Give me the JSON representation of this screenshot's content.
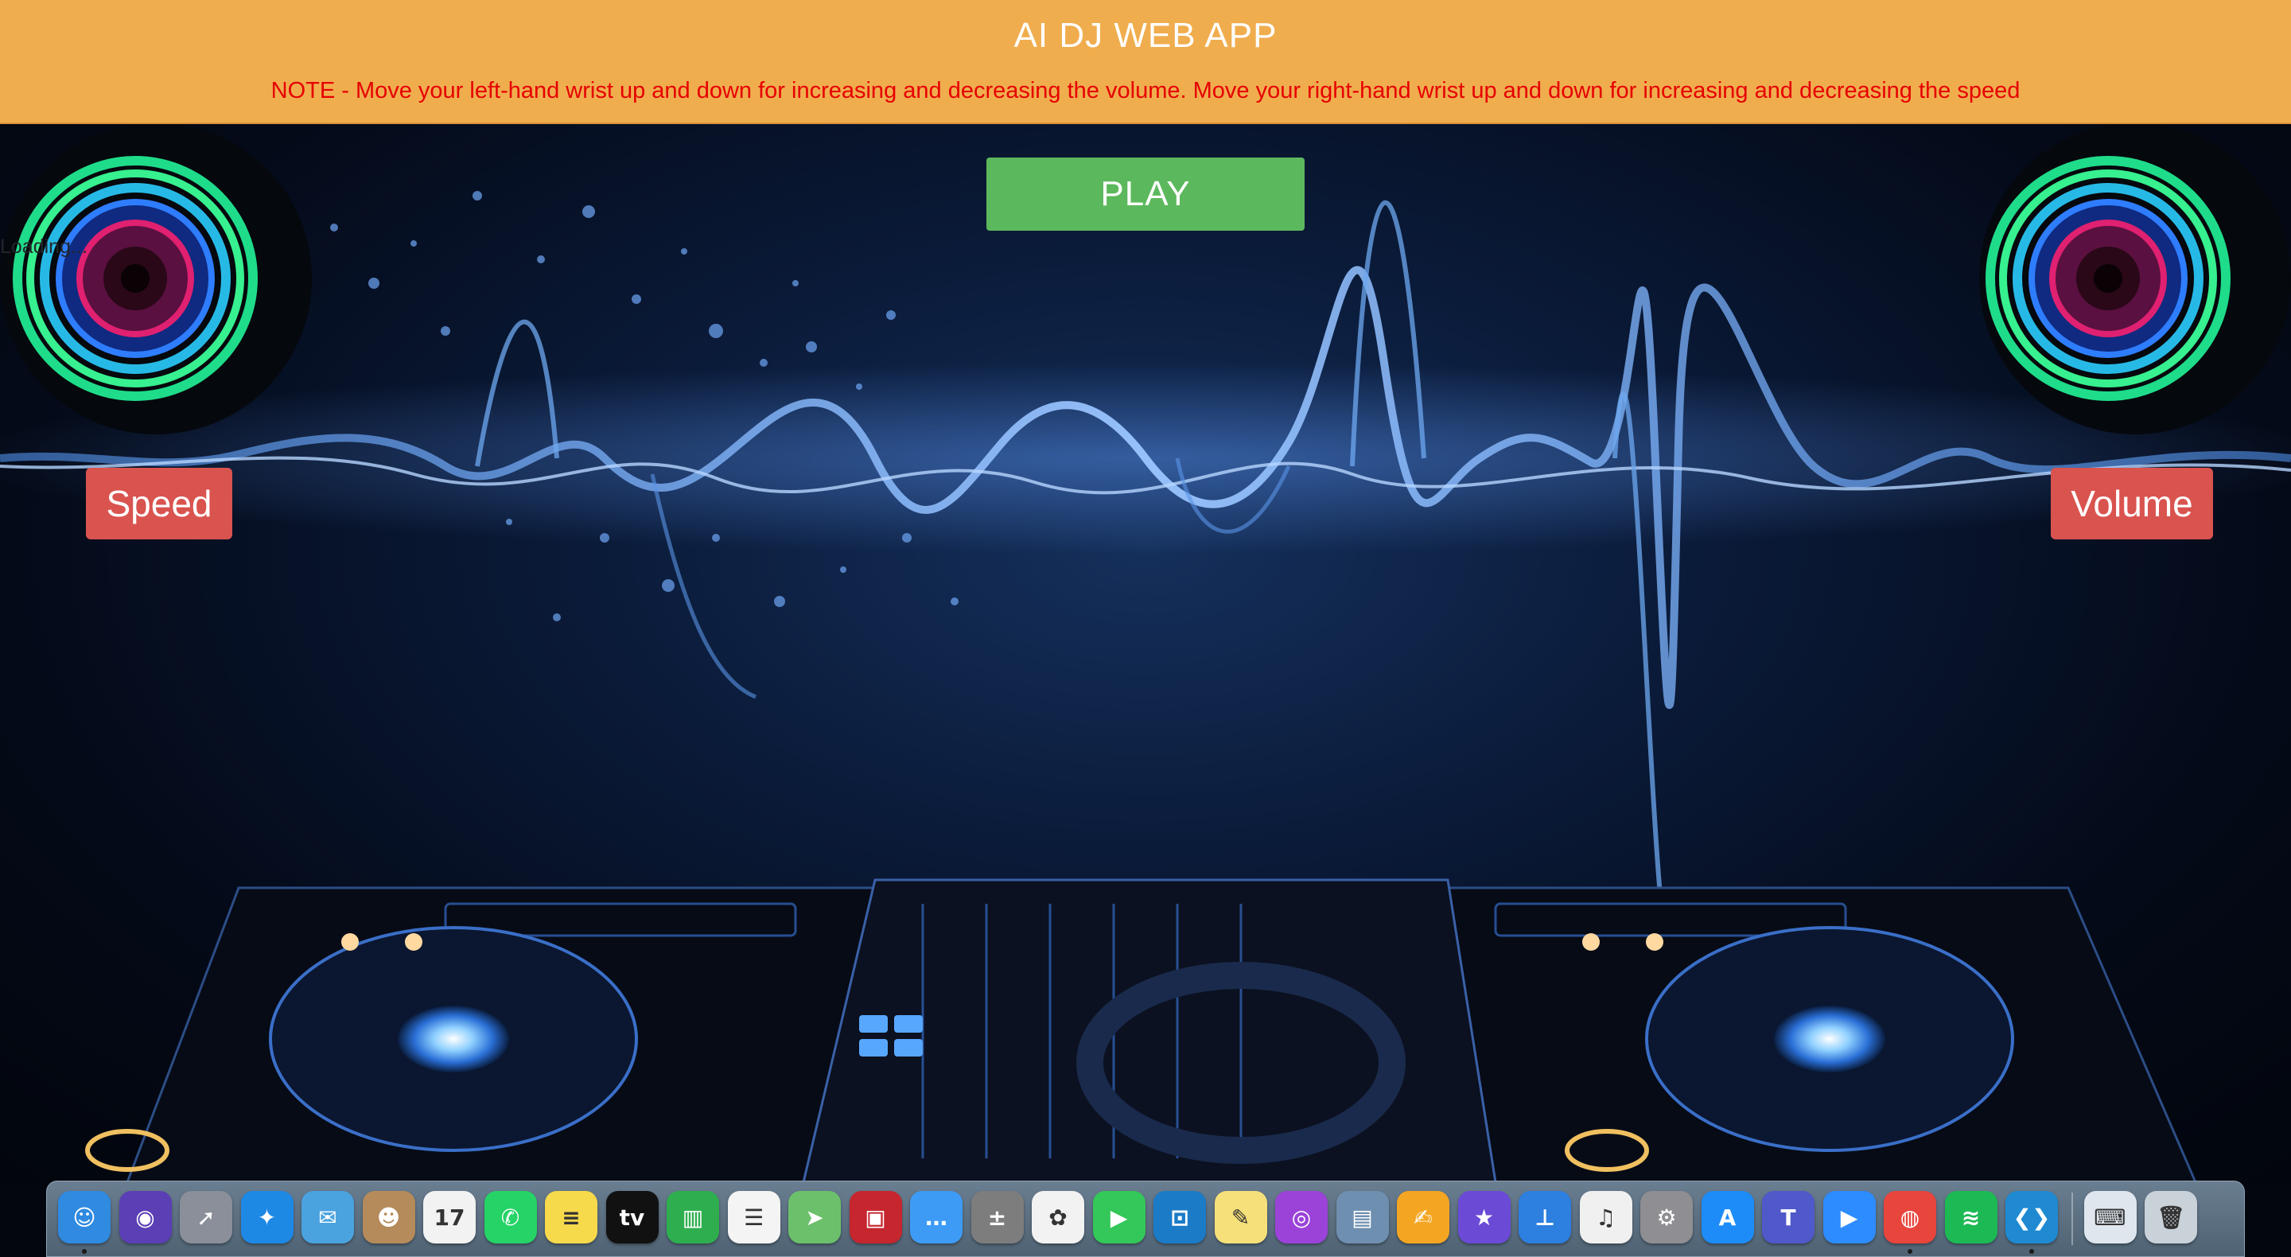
{
  "header": {
    "title": "AI DJ WEB APP",
    "note": "NOTE - Move your left-hand wrist up and down for increasing and decreasing the volume. Move your right-hand wrist up and down for increasing and decreasing the speed"
  },
  "controls": {
    "play_label": "PLAY",
    "speed_label": "Speed",
    "volume_label": "Volume",
    "loading_text": "Loading..."
  },
  "colors": {
    "header_bg": "#f0ad4e",
    "note_text": "#e60000",
    "play_bg": "#5cb85c",
    "control_bg": "#d9534f"
  },
  "dock": {
    "apps": [
      {
        "name": "finder-icon",
        "glyph": "☺",
        "color": "#2f8ae0",
        "running": true
      },
      {
        "name": "siri-icon",
        "glyph": "◉",
        "color": "#5b3fb5",
        "running": false
      },
      {
        "name": "launchpad-icon",
        "glyph": "➚",
        "color": "#8a8f99",
        "running": false
      },
      {
        "name": "safari-icon",
        "glyph": "✦",
        "color": "#1e88e5",
        "running": false
      },
      {
        "name": "mail-icon",
        "glyph": "✉",
        "color": "#4aa3df",
        "running": false
      },
      {
        "name": "contacts-icon",
        "glyph": "☻",
        "color": "#b58b5b",
        "running": false
      },
      {
        "name": "calendar-icon",
        "glyph": "17",
        "color": "#f2f2f2",
        "running": false
      },
      {
        "name": "whatsapp-icon",
        "glyph": "✆",
        "color": "#25d366",
        "running": false
      },
      {
        "name": "notes-icon",
        "glyph": "≡",
        "color": "#f7d94c",
        "running": false
      },
      {
        "name": "apple-tv-icon",
        "glyph": "tv",
        "color": "#111111",
        "running": false
      },
      {
        "name": "numbers-icon",
        "glyph": "▥",
        "color": "#2fae4f",
        "running": false
      },
      {
        "name": "reminders-icon",
        "glyph": "☰",
        "color": "#f4f4f4",
        "running": false
      },
      {
        "name": "maps-icon",
        "glyph": "➤",
        "color": "#6cc06b",
        "running": false
      },
      {
        "name": "photo-booth-icon",
        "glyph": "▣",
        "color": "#c6262e",
        "running": false
      },
      {
        "name": "messages-icon",
        "glyph": "…",
        "color": "#3e9bf5",
        "running": false
      },
      {
        "name": "calculator-icon",
        "glyph": "±",
        "color": "#7d7d7d",
        "running": false
      },
      {
        "name": "photos-icon",
        "glyph": "✿",
        "color": "#f2f2f2",
        "running": false
      },
      {
        "name": "facetime-icon",
        "glyph": "▶",
        "color": "#34c759",
        "running": false
      },
      {
        "name": "frame-app-icon",
        "glyph": "⊡",
        "color": "#1b7bc7",
        "running": false
      },
      {
        "name": "stickies-icon",
        "glyph": "✎",
        "color": "#f5e07a",
        "running": false
      },
      {
        "name": "podcasts-icon",
        "glyph": "◎",
        "color": "#9b43d9",
        "running": false
      },
      {
        "name": "preview-icon",
        "glyph": "▤",
        "color": "#6f8fb0",
        "running": false
      },
      {
        "name": "pages-icon",
        "glyph": "✍",
        "color": "#f4a623",
        "running": false
      },
      {
        "name": "imovie-icon",
        "glyph": "★",
        "color": "#6b4bd6",
        "running": false
      },
      {
        "name": "keynote-icon",
        "glyph": "⊥",
        "color": "#2d7fe0",
        "running": false
      },
      {
        "name": "music-icon",
        "glyph": "♫",
        "color": "#f0f0f0",
        "running": false
      },
      {
        "name": "system-preferences-icon",
        "glyph": "⚙",
        "color": "#8e8e93",
        "running": false
      },
      {
        "name": "app-store-icon",
        "glyph": "A",
        "color": "#1d8cf8",
        "running": false
      },
      {
        "name": "teams-icon",
        "glyph": "T",
        "color": "#5059c9",
        "running": false
      },
      {
        "name": "zoom-icon",
        "glyph": "▶",
        "color": "#2d8cff",
        "running": false
      },
      {
        "name": "chrome-icon",
        "glyph": "◍",
        "color": "#e8453c",
        "running": true
      },
      {
        "name": "spotify-icon",
        "glyph": "≋",
        "color": "#1db954",
        "running": false
      },
      {
        "name": "vscode-icon",
        "glyph": "❮❯",
        "color": "#1f8ad2",
        "running": true
      },
      {
        "name": "keyboard-viewer-icon",
        "glyph": "⌨",
        "color": "#dfe6ee",
        "running": false
      },
      {
        "name": "trash-icon",
        "glyph": "🗑",
        "color": "#c9d1d9",
        "running": false
      }
    ]
  }
}
